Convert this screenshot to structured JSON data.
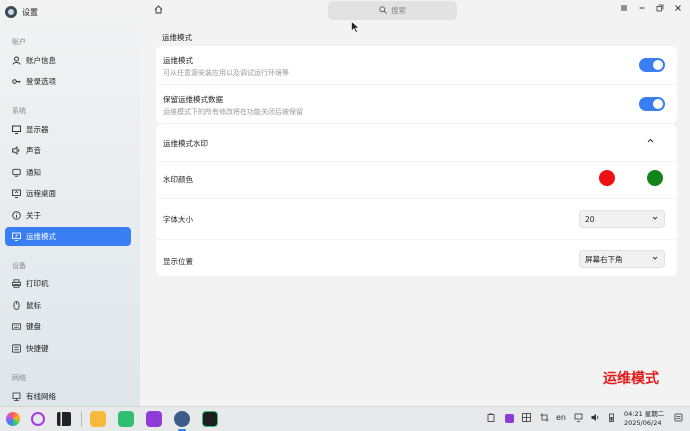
{
  "app": {
    "title": "设置"
  },
  "sidebar": {
    "sections": [
      {
        "label": "账户",
        "items": [
          {
            "label": "账户信息",
            "icon": "user-icon"
          },
          {
            "label": "登录选项",
            "icon": "key-icon"
          }
        ]
      },
      {
        "label": "系统",
        "items": [
          {
            "label": "显示器",
            "icon": "monitor-icon"
          },
          {
            "label": "声音",
            "icon": "speaker-icon"
          },
          {
            "label": "通知",
            "icon": "bell-icon"
          },
          {
            "label": "远程桌面",
            "icon": "remote-desktop-icon"
          },
          {
            "label": "关于",
            "icon": "info-icon"
          },
          {
            "label": "运维模式",
            "icon": "ops-mode-icon",
            "active": true
          }
        ]
      },
      {
        "label": "设备",
        "items": [
          {
            "label": "打印机",
            "icon": "printer-icon"
          },
          {
            "label": "鼠标",
            "icon": "mouse-icon"
          },
          {
            "label": "键盘",
            "icon": "keyboard-icon"
          },
          {
            "label": "快捷键",
            "icon": "shortcut-icon"
          }
        ]
      },
      {
        "label": "网络",
        "items": [
          {
            "label": "有线网络",
            "icon": "ethernet-icon"
          }
        ]
      }
    ]
  },
  "topbar": {
    "search_placeholder": "搜索"
  },
  "main": {
    "group_title": "运维模式",
    "ops_mode": {
      "label": "运维模式",
      "desc": "可从任意源安装应用以及调试运行环境等",
      "enabled": true
    },
    "keep_data": {
      "label": "保留运维模式数据",
      "desc": "运维模式下的所有修改将在功能关闭后被保留",
      "enabled": true
    },
    "watermark_section": {
      "label": "运维模式水印",
      "expanded": true
    },
    "watermark_color": {
      "label": "水印颜色",
      "options": [
        "#ee1111",
        "#11851a"
      ]
    },
    "font_size": {
      "label": "字体大小",
      "value": "20"
    },
    "position": {
      "label": "显示位置",
      "value": "屏幕右下角"
    }
  },
  "overlay_watermark": {
    "text": "运维模式",
    "color": "#e31b1b"
  },
  "taskbar": {
    "clock_time": "04:21 星期二",
    "clock_date": "2025/06/24",
    "lang": "en"
  },
  "colors": {
    "accent": "#3a7ef4"
  }
}
